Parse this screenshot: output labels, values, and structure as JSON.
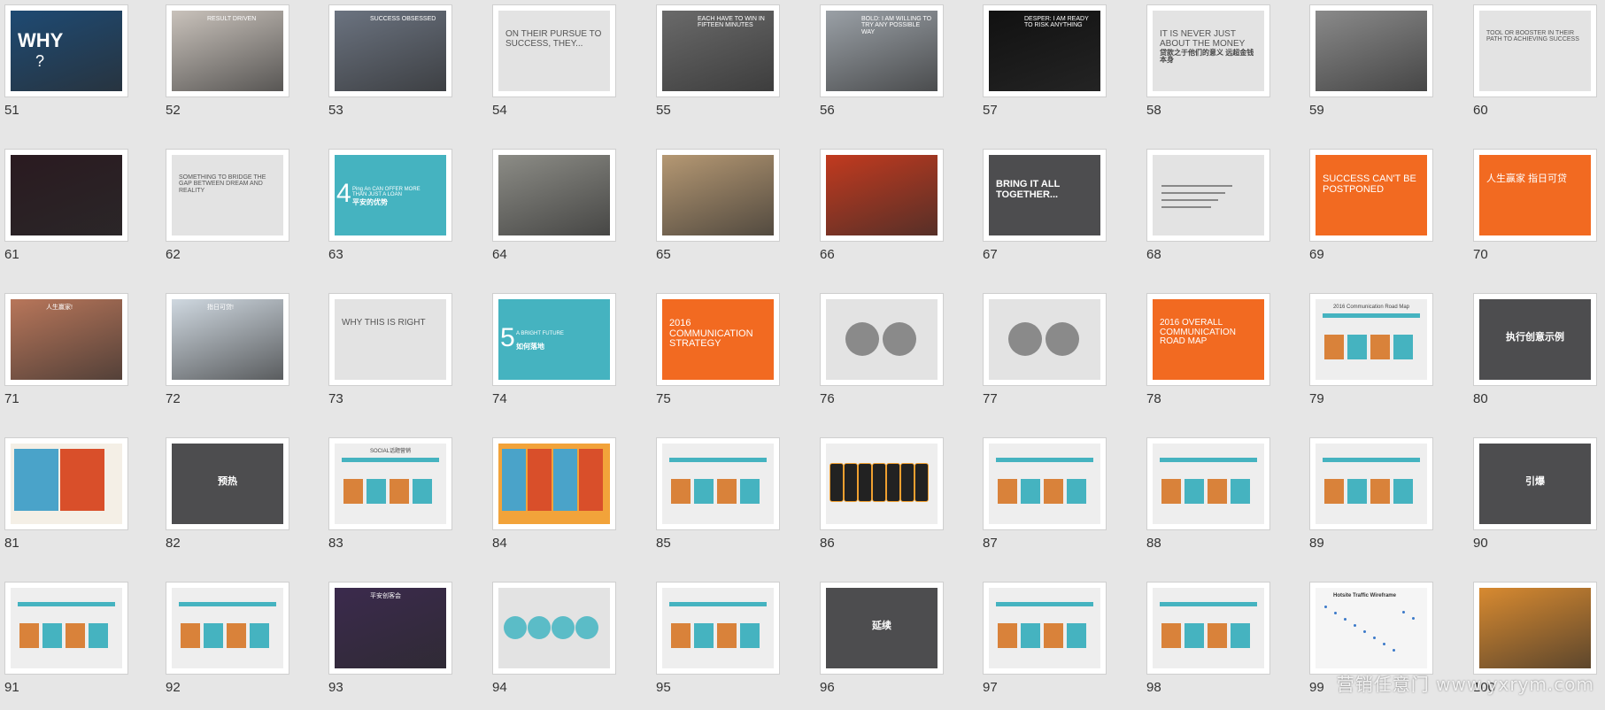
{
  "slides": [
    {
      "n": "51",
      "kind": "photo",
      "bg": "#1e4a73",
      "texts": [
        "WHY",
        "?"
      ]
    },
    {
      "n": "52",
      "kind": "photo",
      "bg": "#c9c2bb",
      "texts": [
        "RESULT DRIVEN"
      ]
    },
    {
      "n": "53",
      "kind": "photo",
      "bg": "#6b7380",
      "texts": [
        "SUCCESS OBSESSED"
      ]
    },
    {
      "n": "54",
      "kind": "text",
      "bg": "#e3e3e3",
      "texts": [
        "ON THEIR PURSUE TO SUCCESS, THEY..."
      ]
    },
    {
      "n": "55",
      "kind": "photo",
      "bg": "#6a6a6a",
      "texts": [
        "EACH HAVE TO WIN IN FIFTEEN MINUTES"
      ]
    },
    {
      "n": "56",
      "kind": "photo",
      "bg": "#9aa0a6",
      "texts": [
        "BOLD: I AM WILLING TO TRY ANY POSSIBLE WAY"
      ]
    },
    {
      "n": "57",
      "kind": "photo",
      "bg": "#111111",
      "texts": [
        "DESPER: I AM READY TO RISK ANYTHING"
      ]
    },
    {
      "n": "58",
      "kind": "text",
      "bg": "#e3e3e3",
      "texts": [
        "IT IS NEVER JUST ABOUT THE MONEY",
        "贷款之于他们的意义 远超金钱本身"
      ]
    },
    {
      "n": "59",
      "kind": "photo",
      "bg": "#8a8a8a",
      "texts": []
    },
    {
      "n": "60",
      "kind": "text",
      "bg": "#e3e3e3",
      "texts": [
        "TOOL OR BOOSTER IN THEIR PATH TO ACHIEVING SUCCESS"
      ]
    },
    {
      "n": "61",
      "kind": "photo",
      "bg": "#2a1a20",
      "texts": []
    },
    {
      "n": "62",
      "kind": "text",
      "bg": "#e3e3e3",
      "texts": [
        "SOMETHING TO BRIDGE THE GAP BETWEEN DREAM AND REALITY"
      ]
    },
    {
      "n": "63",
      "kind": "teal",
      "bg": "#45b3c0",
      "texts": [
        "4",
        "Ping An CAN OFFER MORE THAN JUST A LOAN",
        "平安的优势"
      ]
    },
    {
      "n": "64",
      "kind": "photo",
      "bg": "#8c8c86",
      "texts": []
    },
    {
      "n": "65",
      "kind": "photo",
      "bg": "#b59873",
      "texts": []
    },
    {
      "n": "66",
      "kind": "photo",
      "bg": "#c23a1f",
      "texts": []
    },
    {
      "n": "67",
      "kind": "dark",
      "bg": "#4d4d4f",
      "texts": [
        "BRING IT ALL TOGETHER..."
      ]
    },
    {
      "n": "68",
      "kind": "text",
      "bg": "#e3e3e3",
      "texts": []
    },
    {
      "n": "69",
      "kind": "orange",
      "bg": "#f26a21",
      "texts": [
        "SUCCESS CAN'T BE POSTPONED"
      ]
    },
    {
      "n": "70",
      "kind": "orange",
      "bg": "#f26a21",
      "texts": [
        "人生赢家 指日可贷"
      ]
    },
    {
      "n": "71",
      "kind": "photo",
      "bg": "#b8765a",
      "texts": [
        "人生赢家!"
      ]
    },
    {
      "n": "72",
      "kind": "photo",
      "bg": "#cfd8e0",
      "texts": [
        "指日可贷!"
      ]
    },
    {
      "n": "73",
      "kind": "text",
      "bg": "#e3e3e3",
      "texts": [
        "WHY THIS IS RIGHT"
      ]
    },
    {
      "n": "74",
      "kind": "teal",
      "bg": "#45b3c0",
      "texts": [
        "5",
        "A BRIGHT FUTURE",
        "如何落地"
      ]
    },
    {
      "n": "75",
      "kind": "orange",
      "bg": "#f26a21",
      "texts": [
        "2016 COMMUNICATION STRATEGY"
      ]
    },
    {
      "n": "76",
      "kind": "circles",
      "bg": "#e3e3e3",
      "texts": []
    },
    {
      "n": "77",
      "kind": "circles",
      "bg": "#e3e3e3",
      "texts": []
    },
    {
      "n": "78",
      "kind": "orange",
      "bg": "#f26a21",
      "texts": [
        "2016 OVERALL COMMUNICATION ROAD MAP"
      ]
    },
    {
      "n": "79",
      "kind": "table",
      "bg": "#eeeeee",
      "texts": [
        "2016 Communication Road Map"
      ]
    },
    {
      "n": "80",
      "kind": "dark",
      "bg": "#4d4d4f",
      "texts": [
        "执行创意示例"
      ]
    },
    {
      "n": "81",
      "kind": "poster",
      "bg": "#f4efe6",
      "texts": []
    },
    {
      "n": "82",
      "kind": "dark",
      "bg": "#4d4d4f",
      "texts": [
        "预热"
      ]
    },
    {
      "n": "83",
      "kind": "table",
      "bg": "#eeeeee",
      "texts": [
        "SOCIAL话题营销"
      ]
    },
    {
      "n": "84",
      "kind": "poster",
      "bg": "#f2a33a",
      "texts": []
    },
    {
      "n": "85",
      "kind": "table",
      "bg": "#eeeeee",
      "texts": []
    },
    {
      "n": "86",
      "kind": "phones",
      "bg": "#eeeeee",
      "texts": []
    },
    {
      "n": "87",
      "kind": "table",
      "bg": "#eeeeee",
      "texts": []
    },
    {
      "n": "88",
      "kind": "table",
      "bg": "#eeeeee",
      "texts": []
    },
    {
      "n": "89",
      "kind": "table",
      "bg": "#eeeeee",
      "texts": []
    },
    {
      "n": "90",
      "kind": "dark",
      "bg": "#4d4d4f",
      "texts": [
        "引爆"
      ]
    },
    {
      "n": "91",
      "kind": "table",
      "bg": "#eeeeee",
      "texts": []
    },
    {
      "n": "92",
      "kind": "table",
      "bg": "#eeeeee",
      "texts": []
    },
    {
      "n": "93",
      "kind": "photo",
      "bg": "#3b2a4d",
      "texts": [
        "平安创客会"
      ]
    },
    {
      "n": "94",
      "kind": "circles",
      "bg": "#e3e3e3",
      "texts": []
    },
    {
      "n": "95",
      "kind": "table",
      "bg": "#eeeeee",
      "texts": []
    },
    {
      "n": "96",
      "kind": "dark",
      "bg": "#4d4d4f",
      "texts": [
        "延续"
      ]
    },
    {
      "n": "97",
      "kind": "table",
      "bg": "#eeeeee",
      "texts": []
    },
    {
      "n": "98",
      "kind": "table",
      "bg": "#eeeeee",
      "texts": []
    },
    {
      "n": "99",
      "kind": "map",
      "bg": "#f5f5f5",
      "texts": [
        "Hotsite Traffic Wireframe"
      ]
    },
    {
      "n": "100",
      "kind": "photo",
      "bg": "#d88a30",
      "texts": []
    }
  ],
  "watermark": "营销任意门 www.yxrym.com",
  "colors": {
    "teal": "#45b3c0",
    "orange": "#f26a21",
    "dark": "#4d4d4f"
  }
}
